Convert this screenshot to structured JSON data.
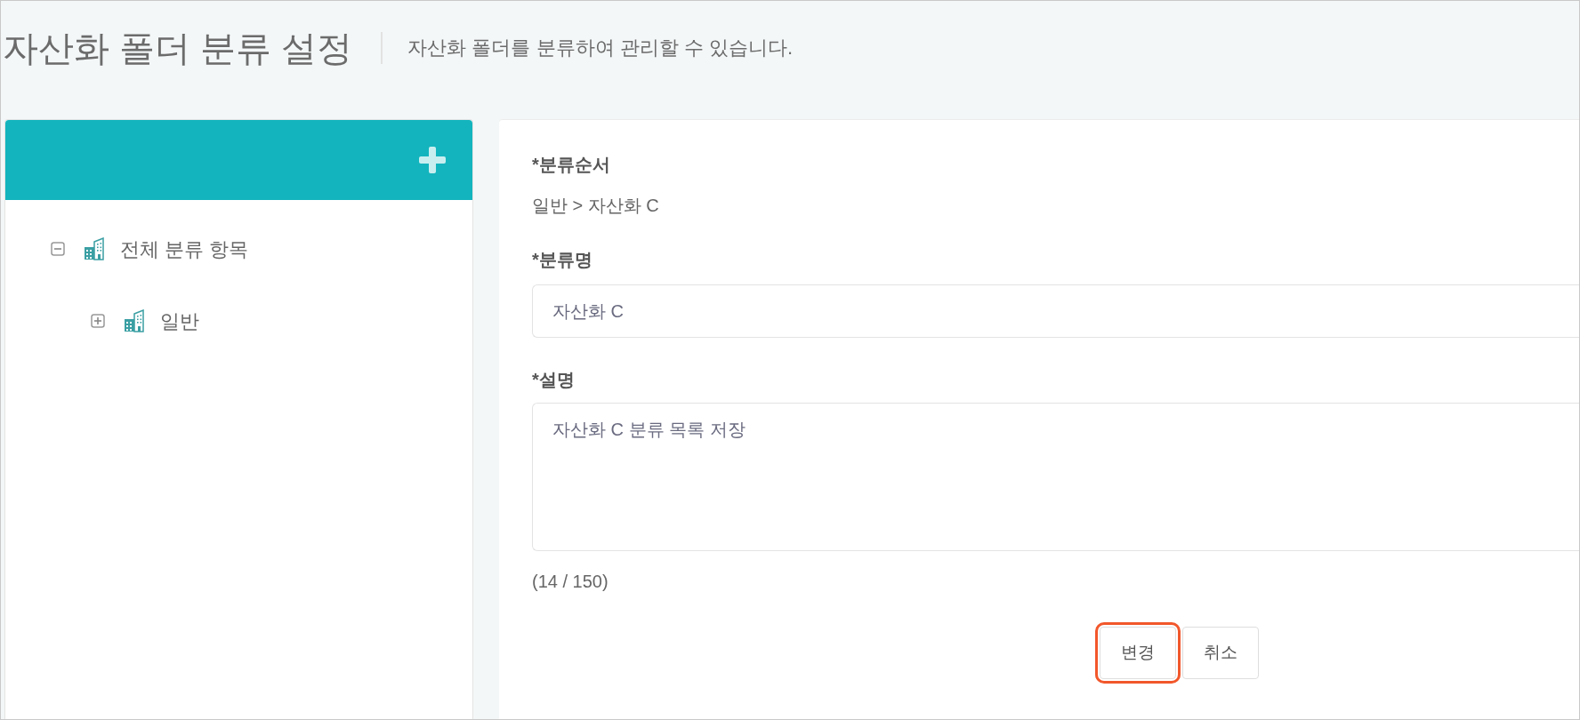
{
  "page": {
    "title": "자산화 폴더 분류 설정",
    "subtitle": "자산화 폴더를 분류하여 관리할 수 있습니다."
  },
  "tree": {
    "items": [
      {
        "label": "전체 분류 항목",
        "expanded": true,
        "children": [
          {
            "label": "일반",
            "expanded": false
          }
        ]
      }
    ]
  },
  "form": {
    "fields": [
      {
        "kind": "text",
        "label": "*분류순서",
        "value": "일반 > 자산화 C"
      },
      {
        "kind": "input",
        "label": "*분류명",
        "value": "자산화 C"
      },
      {
        "kind": "textarea",
        "label": "*설명",
        "value": "자산화 C 분류 목록 저장",
        "counter": "(14 / 150)"
      }
    ],
    "buttons": [
      {
        "label": "변경",
        "highlighted": true
      },
      {
        "label": "취소",
        "highlighted": false
      }
    ]
  }
}
